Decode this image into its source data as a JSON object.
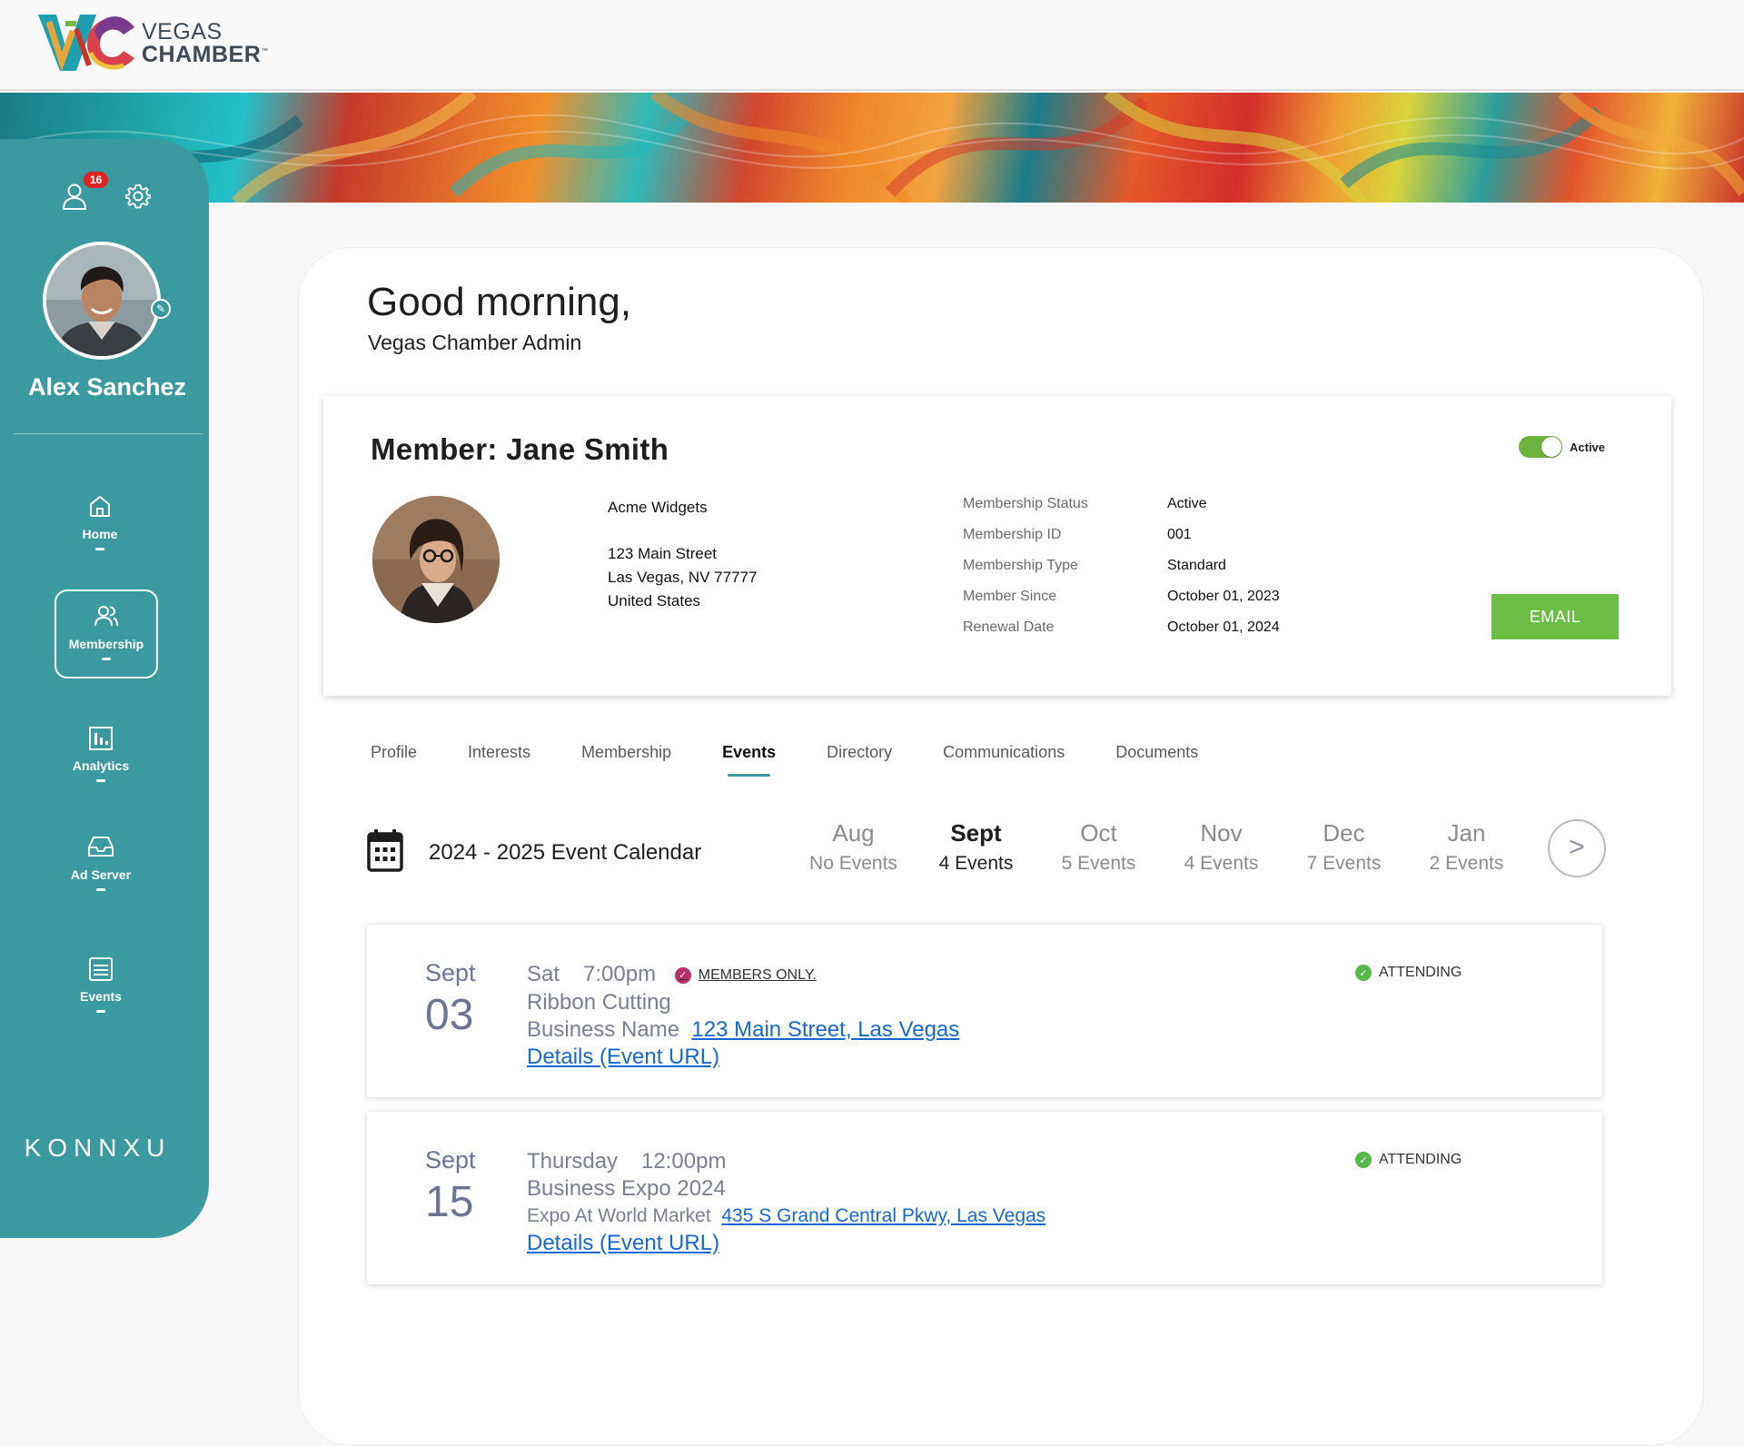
{
  "brand": {
    "line1": "VEGAS",
    "line2": "CHAMBER",
    "tm": "™",
    "accent": "#3b9aa0",
    "green": "#6cbd45"
  },
  "sidebar": {
    "notification_count": "16",
    "user_name": "Alex Sanchez",
    "nav": [
      {
        "label": "Home",
        "icon": "home-icon"
      },
      {
        "label": "Membership",
        "icon": "users-icon",
        "active": true
      },
      {
        "label": "Analytics",
        "icon": "analytics-icon"
      },
      {
        "label": "Ad Server",
        "icon": "inbox-icon"
      },
      {
        "label": "Events",
        "icon": "events-icon"
      }
    ],
    "footer_brand": "KONNXU"
  },
  "greeting": {
    "title": "Good morning,",
    "subtitle": "Vegas Chamber Admin"
  },
  "member": {
    "title": "Member:  Jane Smith",
    "status_toggle_label": "Active",
    "company": "Acme Widgets",
    "address_line1": "123 Main Street",
    "address_line2": "Las Vegas, NV 77777",
    "address_line3": "United States",
    "details": [
      {
        "key": "Membership Status",
        "value": "Active"
      },
      {
        "key": "Membership ID",
        "value": "001"
      },
      {
        "key": "Membership Type",
        "value": "Standard"
      },
      {
        "key": "Member Since",
        "value": "October 01, 2023"
      },
      {
        "key": "Renewal Date",
        "value": "October 01, 2024"
      }
    ],
    "email_button": "EMAIL"
  },
  "tabs": [
    {
      "label": "Profile"
    },
    {
      "label": "Interests"
    },
    {
      "label": "Membership"
    },
    {
      "label": "Events",
      "active": true
    },
    {
      "label": "Directory"
    },
    {
      "label": "Communications"
    },
    {
      "label": "Documents"
    }
  ],
  "calendar": {
    "title": "2024 - 2025 Event Calendar",
    "next_label": ">",
    "months": [
      {
        "name": "Aug",
        "events": "No Events"
      },
      {
        "name": "Sept",
        "events": "4 Events",
        "active": true
      },
      {
        "name": "Oct",
        "events": "5 Events"
      },
      {
        "name": "Nov",
        "events": "4 Events"
      },
      {
        "name": "Dec",
        "events": "7 Events"
      },
      {
        "name": "Jan",
        "events": "2 Events"
      }
    ]
  },
  "events": [
    {
      "month": "Sept",
      "day": "03",
      "weekday": "Sat",
      "time": "7:00pm",
      "badge": "MEMBERS ONLY.",
      "name": "Ribbon Cutting",
      "venue": "Business Name",
      "address": "123 Main Street, Las Vegas",
      "details_link": "Details (Event URL)",
      "status": "ATTENDING"
    },
    {
      "month": "Sept",
      "day": "15",
      "weekday": "Thursday",
      "time": "12:00pm",
      "name": "Business Expo 2024",
      "venue": "Expo At World Market",
      "address": "435 S Grand Central Pkwy, Las Vegas",
      "details_link": "Details (Event URL)",
      "status": "ATTENDING"
    }
  ]
}
